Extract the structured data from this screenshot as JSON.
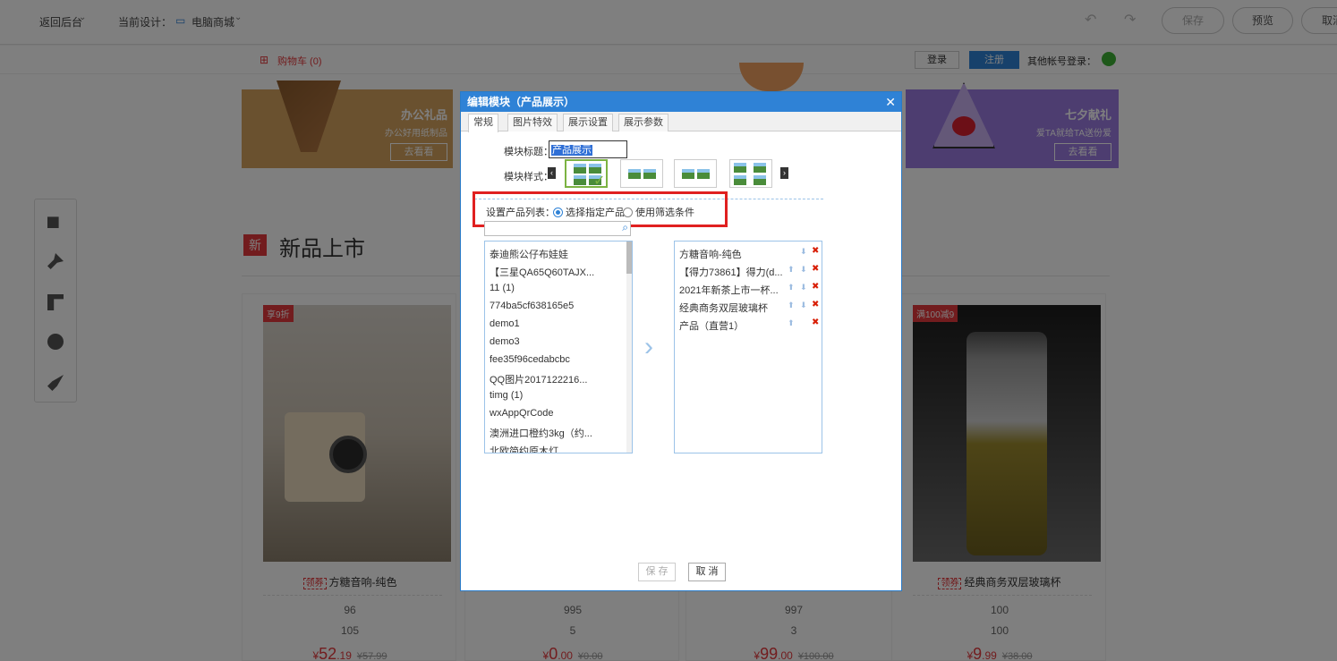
{
  "topbar": {
    "back": "返回后台",
    "current_label": "当前设计：",
    "design": "电脑商城",
    "save": "保存",
    "preview": "预览",
    "cancel": "取消"
  },
  "site": {
    "cart": "购物车 (0)",
    "login": "登录",
    "register": "注册",
    "other_login": "其他帐号登录："
  },
  "banners": [
    {
      "title": "办公礼品",
      "sub": "办公好用纸制品",
      "btn": "去看看",
      "color": "#d4a25f"
    },
    {
      "title": "七夕献礼",
      "sub": "爱TA就给TA送份爱",
      "btn": "去看看",
      "color": "#9b7be0"
    }
  ],
  "section": {
    "title": "新品上市"
  },
  "products": [
    {
      "badge": "享9折",
      "coupon": "领券",
      "name": "方糖音响-纯色",
      "n1": "96",
      "n2": "105",
      "price_big": "52",
      "price_small": ".19",
      "old": "¥57.99"
    },
    {
      "badge": "",
      "coupon": "",
      "name": "",
      "n1": "995",
      "n2": "5",
      "price_big": "0",
      "price_small": ".00",
      "old": "¥0.00"
    },
    {
      "badge": "",
      "coupon": "",
      "name": "",
      "n1": "997",
      "n2": "3",
      "price_big": "99",
      "price_small": ".00",
      "old": "¥100.00"
    },
    {
      "badge": "满100减9",
      "coupon": "领券",
      "name": "经典商务双层玻璃杯",
      "n1": "100",
      "n2": "100",
      "price_big": "9",
      "price_small": ".99",
      "old": "¥38.00"
    }
  ],
  "modal": {
    "title": "编辑模块（产品展示）",
    "close": "✕",
    "tabs": [
      "常规",
      "图片特效",
      "展示设置",
      "展示参数"
    ],
    "title_label": "模块标题：",
    "title_value": "产品展示",
    "style_label": "模块样式：",
    "list_label": "设置产品列表：",
    "opt1": "选择指定产品",
    "opt2": "使用筛选条件",
    "left_items": [
      "泰迪熊公仔布娃娃",
      "【三星QA65Q60TAJX...",
      "11 (1)",
      "774ba5cf638165e5",
      "demo1",
      "demo3",
      "fee35f96cedabcbc",
      "QQ图片2017122216...",
      "timg (1)",
      "wxAppQrCode",
      "澳洲进口橙约3kg（约...",
      "北欧简约原木灯"
    ],
    "right_items": [
      "方糖音响-纯色",
      "【得力73861】得力(d...",
      "2021年新茶上市一杯...",
      "经典商务双层玻璃杯",
      "产品（直营1）"
    ],
    "save": "保 存",
    "cancel": "取 消"
  }
}
